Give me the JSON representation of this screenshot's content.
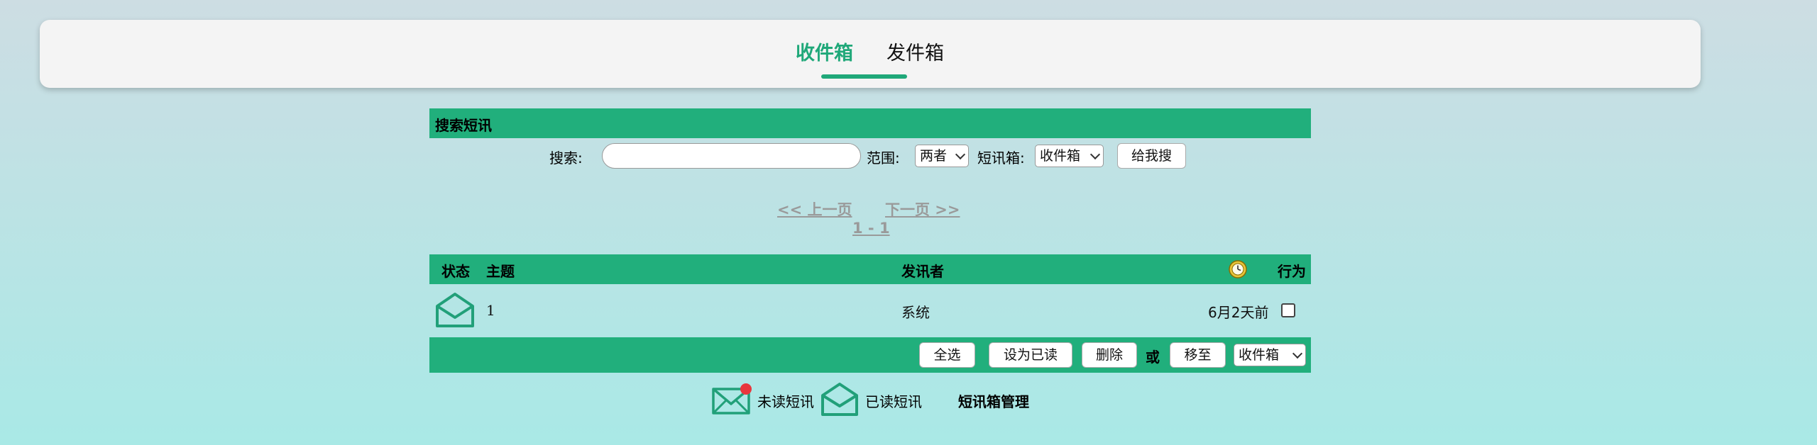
{
  "tabs": {
    "inbox": "收件箱",
    "outbox": "发件箱"
  },
  "search": {
    "header": "搜索短讯",
    "keyword_label": "搜索:",
    "keyword_value": "",
    "range_label": "范围:",
    "range_value": "两者",
    "box_label": "短讯箱:",
    "box_value": "收件箱",
    "submit_label": "给我搜"
  },
  "pagination": {
    "prev": "<< 上一页",
    "next": "下一页 >>",
    "range": "1 - 1"
  },
  "table": {
    "headers": {
      "status": "状态",
      "subject": "主题",
      "sender": "发讯者",
      "time_icon": "clock-icon",
      "action": "行为"
    },
    "rows": [
      {
        "status_icon": "read-envelope-icon",
        "subject": "1",
        "sender": "系统",
        "time": "6月2天前",
        "selected": false
      }
    ]
  },
  "actions": {
    "select_all": "全选",
    "mark_read": "设为已读",
    "delete": "删除",
    "or": "或",
    "move_to": "移至",
    "target_box": "收件箱"
  },
  "legend": {
    "unread": "未读短讯",
    "read": "已读短讯",
    "manage": "短讯箱管理"
  },
  "colors": {
    "accent": "#21af7c",
    "tab_active": "#1fa879",
    "unread_dot": "#e8373d",
    "clock": "#e7c53b"
  }
}
